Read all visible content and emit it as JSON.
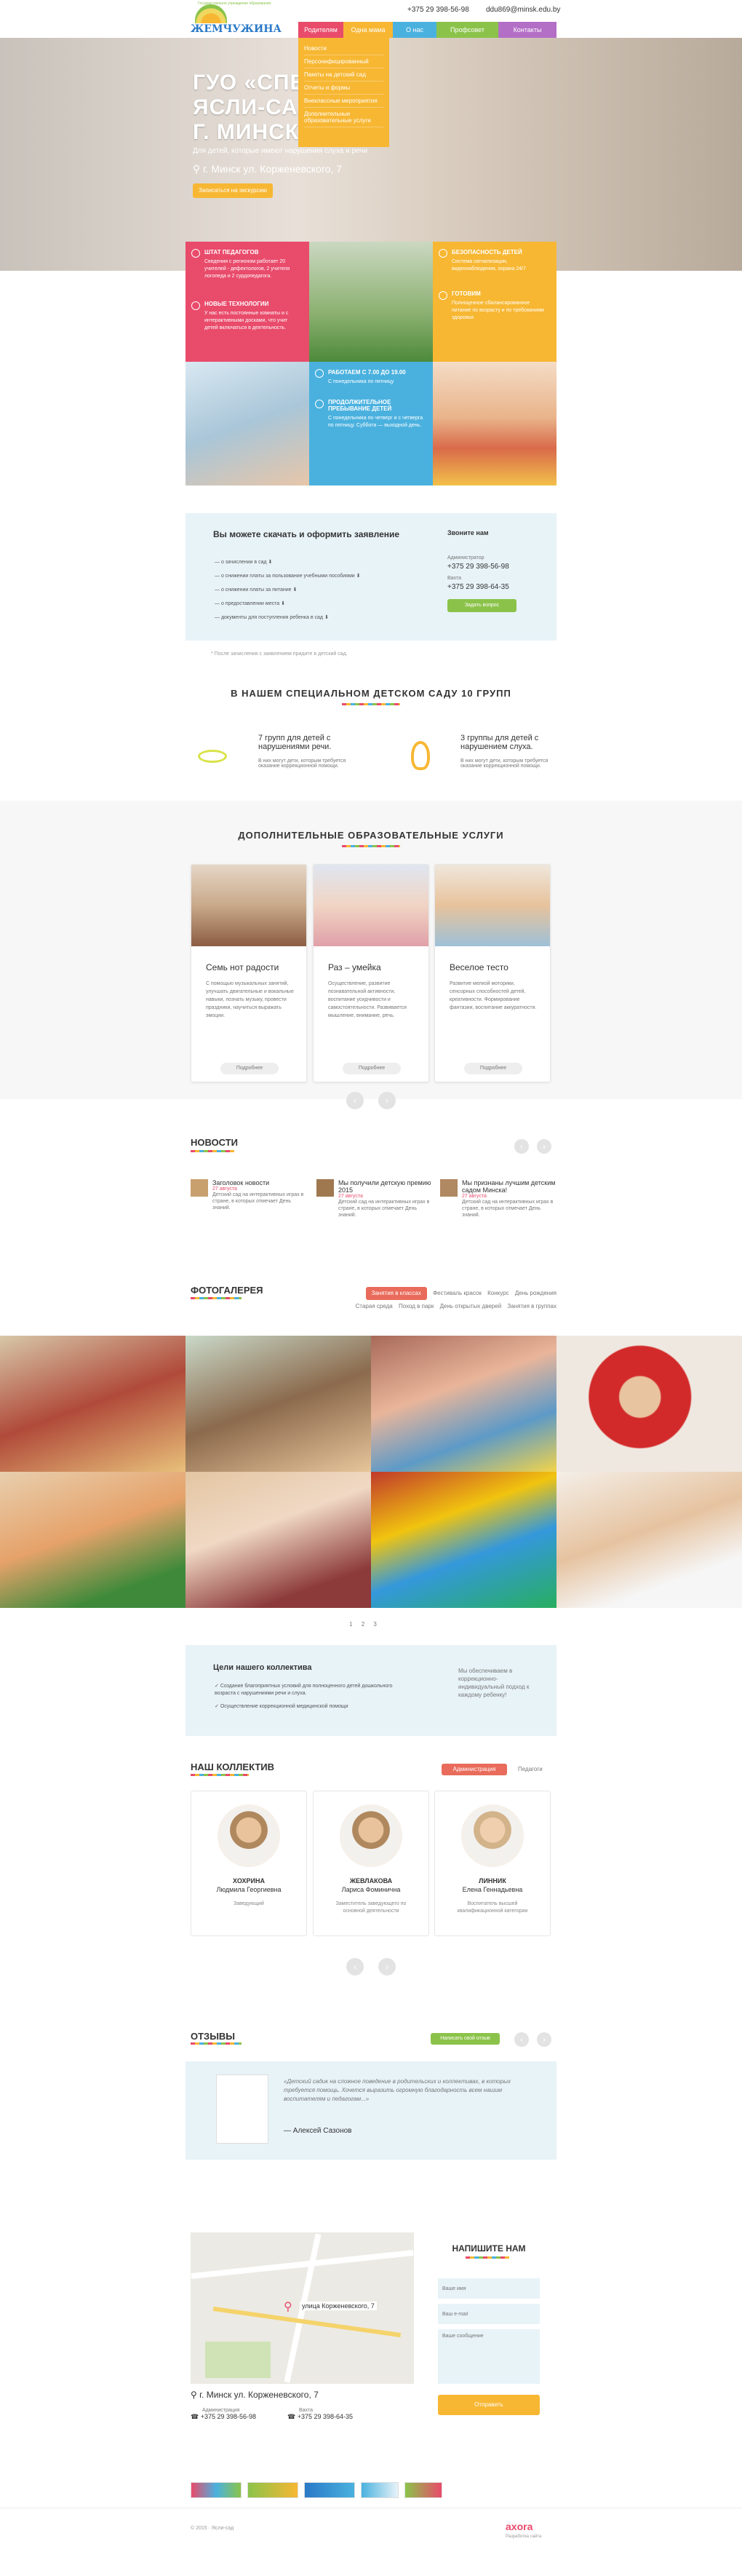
{
  "header": {
    "logo_small": "Государственное учреждение образования",
    "logo": "ЖЕМЧУЖИНА",
    "phone": "+375 29 398-56-98",
    "email": "ddu869@minsk.edu.by",
    "nav": [
      "Родителям",
      "Одна мама",
      "О нас",
      "Профсовет",
      "Контакты"
    ]
  },
  "dropdown": [
    "Новости",
    "Персонифицированный",
    "Пакеты на детский сад",
    "Отчеты и формы",
    "Внеклассные мероприятия",
    "Дополнительные образовательные услуги"
  ],
  "hero": {
    "title_lines": [
      "ГУО «СПЕЦ",
      "ЯСЛИ-САД",
      "Г. МИНСК"
    ],
    "subtitle": "Для детей, которые имеют нарушения слуха и речи",
    "address": "г. Минск ул. Корженевского, 7",
    "button": "Записаться на экскурсию"
  },
  "tiles": [
    {
      "title": "ШТАТ ПЕДАГОГОВ",
      "text": "Сведения с регионом работает 20 учителей - дефектологов, 2 учителя логопеда и 2 сурдопедагога."
    },
    {
      "title": "НОВЫЕ ТЕХНОЛОГИИ",
      "text": "У нас есть постоянные комнаты и с интерактивными досками, что учит детей включаться в деятельность."
    },
    {
      "title": "БЕЗОПАСНОСТЬ ДЕТЕЙ",
      "text": "Система сигнализации, видеонаблюдения, охрана 24/7"
    },
    {
      "title": "ГОТОВИМ",
      "text": "Полноценное сбалансированное питание по возрасту и по требованиям здоровья"
    },
    {
      "title": "РАБОТАЕМ С 7.00 ДО 19.00",
      "text": "С понедельника по пятницу"
    },
    {
      "title": "ПРОДОЛЖИТЕЛЬНОЕ ПРЕБЫВАНИЕ ДЕТЕЙ",
      "text": "С понедельника по четверг и с четверга по пятницу. Суббота — выходной день."
    }
  ],
  "docs": {
    "title": "Вы можете скачать и оформить заявление",
    "items": [
      "о зачислении в сад",
      "о снижении платы за пользование учебными пособиями",
      "о снижении платы за питание",
      "о предоставлении места",
      "документы для поступления ребенка в сад"
    ],
    "note": "* После зачисления с заявлением придите в детский сад.",
    "call_title": "Звоните нам",
    "admin_label": "Администратор",
    "admin_phone": "+375 29 398-56-98",
    "vahta_label": "Вахта",
    "vahta_phone": "+375 29 398-64-35",
    "call_button": "Задать вопрос"
  },
  "groups": {
    "title": "В НАШЕМ СПЕЦИАЛЬНОМ ДЕТСКОМ САДУ 10 ГРУПП",
    "a_title": "7 групп для детей с нарушениями речи.",
    "a_text": "В них могут дети, которым требуется оказание коррекционной помощи.",
    "b_title": "3 группы для детей с нарушением слуха.",
    "b_text": "В них могут дети, которым требуется оказание коррекционной помощи."
  },
  "services": {
    "title": "ДОПОЛНИТЕЛЬНЫЕ ОБРАЗОВАТЕЛЬНЫЕ УСЛУГИ",
    "cards": [
      {
        "title": "Семь нот радости",
        "text": "С помощью музыкальных занятий, улучшать двигательные и вокальные навыки, познать музыку, провести праздники, научиться выражать эмоции.",
        "button": "Подробнее"
      },
      {
        "title": "Раз – умейка",
        "text": "Осуществление, развитие познавательной активности, воспитание усидчивости и самостоятельности. Развивается мышление, внимание, речь.",
        "button": "Подробнее"
      },
      {
        "title": "Веселое тесто",
        "text": "Развитие мелкой моторики, сенсорных способностей детей, креативности. Формирование фантазии, воспитание аккуратности.",
        "button": "Подробнее"
      }
    ]
  },
  "news": {
    "title": "НОВОСТИ",
    "items": [
      {
        "title": "Заголовок новости",
        "date": "27 августа",
        "text": "Детский сад на интерактивных играх в стране, в которых отмечает День знаний."
      },
      {
        "title": "Мы получили детскую премию 2015",
        "date": "27 августа",
        "text": "Детский сад на интерактивных играх в стране, в которых отмечает День знаний."
      },
      {
        "title": "Мы признаны лучшим детским садом Минска!",
        "date": "27 августа",
        "text": "Детский сад на интерактивных играх в стране, в которых отмечает День знаний."
      }
    ]
  },
  "gallery": {
    "title": "ФОТОГАЛЕРЕЯ",
    "tabs": [
      "Занятия в классах",
      "Фестиваль красок",
      "Конкурс",
      "День рождения",
      "Старая среда",
      "Поход в парк",
      "День открытых дверей",
      "Занятия в группах"
    ],
    "pages": [
      "1",
      "2",
      "3"
    ]
  },
  "goals": {
    "title": "Цели нашего коллектива",
    "items": [
      "Создание благоприятных условий для полноценного детей дошкольного возраста с нарушениями речи и слуха.",
      "Осуществление коррекционной медицинской помощи"
    ],
    "side": "Мы обеспечиваем в коррекционно-индивидуальный подход к каждому ребенку!"
  },
  "team": {
    "title": "НАШ КОЛЛЕКТИВ",
    "tabs": [
      "Администрация",
      "Педагоги"
    ],
    "members": [
      {
        "surname": "ХОХРИНА",
        "name": "Людмила Георгиевна",
        "role": "Заведующий"
      },
      {
        "surname": "ЖЕВЛАКОВА",
        "name": "Лариса Фоминична",
        "role": "Заместитель заведующего по основной деятельности"
      },
      {
        "surname": "ЛИННИК",
        "name": "Елена Геннадьевна",
        "role": "Воспитатель высшей квалификационной категории"
      }
    ]
  },
  "reviews": {
    "title": "ОТЗЫВЫ",
    "button": "Написать свой отзыв",
    "text": "«Детский садик на сложное поведение в родительских и коллективах, в которых требуется помощь. Хочется выразить огромную благодарность всем нашим воспитателям и педагогам...»",
    "author": "— Алексей Сазонов"
  },
  "contact": {
    "map_label": "улица Корженевского, 7",
    "address": "г. Минск ул. Корженевского, 7",
    "admin_label": "Администрация",
    "admin_phone": "+375 29 398-56-98",
    "vahta_label": "Вахта",
    "vahta_phone": "+375 29 398-64-35",
    "form_title": "НАПИШИТЕ НАМ",
    "name_ph": "Ваше имя",
    "email_ph": "Ваш e-mail",
    "msg_ph": "Ваше сообщение",
    "submit": "Отправить"
  },
  "footer": {
    "copyright": "© 2015 · Ясли-сад",
    "brand": "axora",
    "brand_sub": "Разработка сайта"
  },
  "colors": {
    "pink": "#e94b6b",
    "yellow": "#f7b733",
    "blue": "#4ab1df",
    "green": "#8bc34a",
    "purple": "#b36fc6"
  }
}
